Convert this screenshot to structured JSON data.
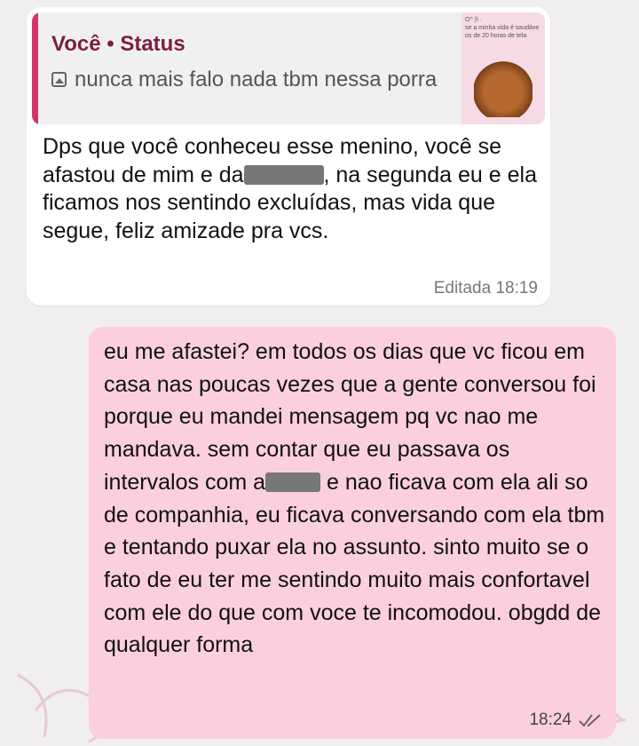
{
  "incoming": {
    "reply": {
      "author": "Você • Status",
      "text": "nunca mais falo nada tbm nessa porra",
      "thumbnail_text": "O^ )\\ ·\nse a minha vida é saudáve\nos de 20 horas de tela"
    },
    "text_before_redaction_1": "Dps que você conheceu esse menino, você se afastou de mim e da",
    "text_after_redaction_1": ", na segunda eu e ela ficamos nos sentindo excluídas, mas vida que segue, feliz amizade pra vcs.",
    "edited_label": "Editada",
    "time": "18:19"
  },
  "outgoing": {
    "text_before_redaction_2": "eu me afastei? em todos os dias que vc ficou em casa nas poucas vezes que a gente conversou foi porque eu mandei mensagem pq vc nao me mandava. sem contar que eu passava os intervalos com a",
    "text_after_redaction_2": " e nao ficava com ela ali so de companhia, eu ficava conversando com ela tbm e tentando puxar ela no assunto. sinto muito se o fato de eu ter me sentindo muito mais confortavel com ele do que com voce te incomodou. obgdd de qualquer forma",
    "time": "18:24",
    "status_icon": "double-check-read-icon"
  },
  "colors": {
    "outgoing_bubble": "#fbd0dc",
    "incoming_bubble": "#ffffff",
    "quote_accent": "#d6336c",
    "quote_author": "#7c1d44"
  }
}
